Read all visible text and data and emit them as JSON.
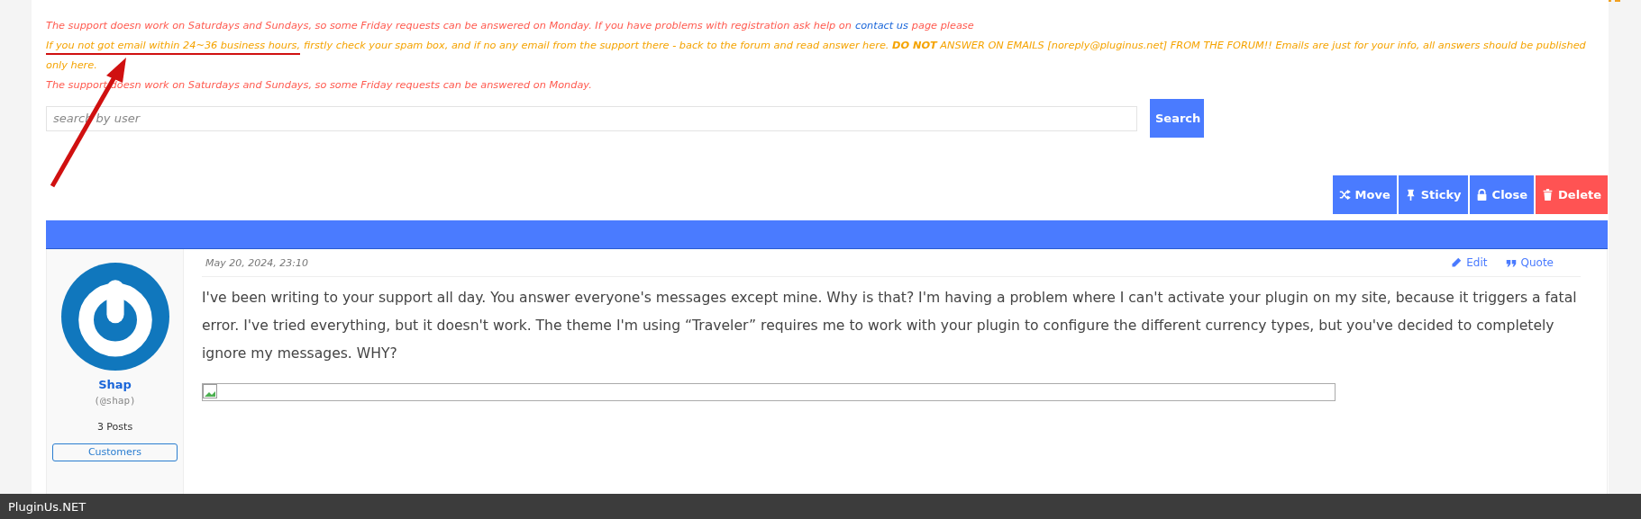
{
  "notices": [
    {
      "kind": "alert",
      "text": "The support doesn work on Saturdays and Sundays, so some Friday requests can be answered on Monday. If you have problems with registration ask help on",
      "link": "contact us",
      "text_after": "page please"
    },
    {
      "kind": "warning",
      "marked": "If you not got email within 24~36 business hours,",
      "text": "firstly check your spam box, and if no any email from the support there - back to the forum and read answer here. **DO NOT** ANSWER ON EMAILS [noreply@pluginus.net] FROM THE FORUM!! Emails are just for your info, all answers should be published only here."
    },
    {
      "kind": "alert",
      "text": "The support doesn work on Saturdays and Sundays, so some Friday requests can be answered on Monday."
    }
  ],
  "search": {
    "placeholder": "search by user",
    "button": "Search"
  },
  "actions": [
    {
      "kind": "move",
      "label": "Move"
    },
    {
      "kind": "sticky",
      "label": "Sticky"
    },
    {
      "kind": "close",
      "label": "Close"
    },
    {
      "kind": "delete",
      "label": "Delete"
    }
  ],
  "post": {
    "author": {
      "name": "Shap",
      "handle": "(@shap)",
      "posts": "3 Posts",
      "role": "Customers"
    },
    "date": "May 20, 2024, 23:10",
    "tools": [
      {
        "kind": "edit",
        "label": "Edit"
      },
      {
        "kind": "quote",
        "label": "Quote"
      }
    ],
    "body": "I've been writing to your support all day. You answer everyone's messages except mine. Why is that? I'm having a problem where I can't activate your plugin on my site, because it triggers a fatal error. I've tried everything, but it doesn't work. The theme I'm using “Traveler” requires me to work with your plugin to configure the different currency types, but you've decided to completely ignore my messages. WHY?"
  },
  "footer": {
    "brand": "PluginUs.NET"
  }
}
